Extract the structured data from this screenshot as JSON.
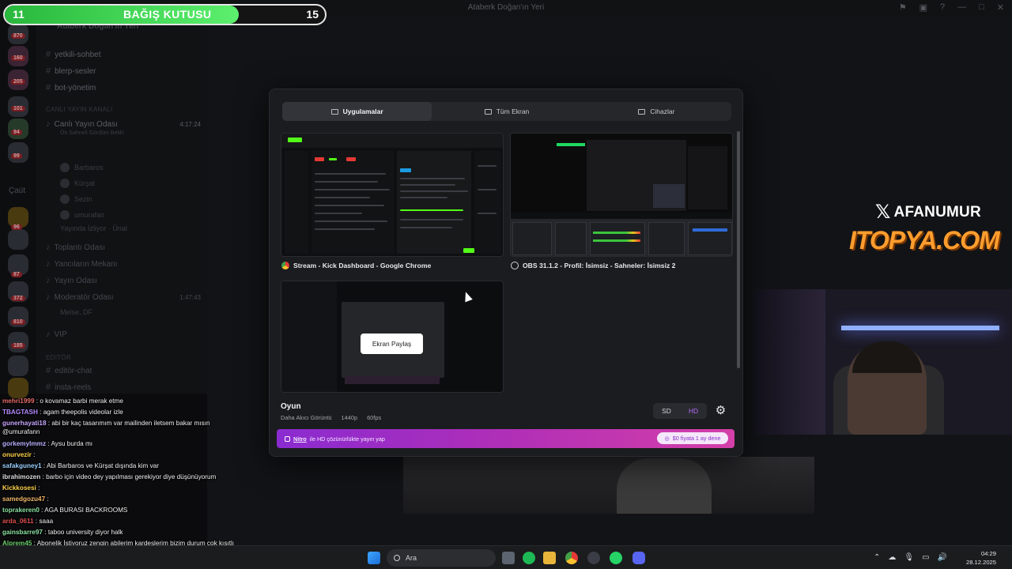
{
  "discord": {
    "server_name": "Ataberk Doğan'ın Yeri",
    "left_label": "Çaüt",
    "channels": [
      {
        "name": "yetkili-sohbet",
        "y": 0
      },
      {
        "name": "blerp-sesler",
        "y": 0
      },
      {
        "name": "bot-yönetim",
        "y": 0
      }
    ],
    "category_live": "CANLI YAYIN KANALI",
    "live_room": "Canlı Yayın Odası",
    "live_room_time": "4:17:24",
    "live_room_sub": "Ön Sahneli Gördüm Bekli!",
    "members": [
      "Barbaros",
      "Kürşat",
      "Sezin",
      "umurafan",
      "Yayında İzliyor · Ünal"
    ],
    "other_rooms": [
      "Toplantı Odası",
      "Yancıların Mekanı",
      "Yayın Odası",
      "Moderatör Odası",
      "VIP"
    ],
    "mod_time": "1:47:43",
    "mod_member": "Meise, DF",
    "category_editor": "Editör",
    "editor_channels": [
      "editör-chat",
      "insta-reels"
    ],
    "rail_badges": [
      "870",
      "160",
      "205",
      "101",
      "94",
      "99",
      "96",
      "87",
      "372",
      "810",
      "185"
    ]
  },
  "donation_bar": {
    "left": "11",
    "label": "BAĞIŞ KUTUSU",
    "right": "15",
    "progress": 0.73
  },
  "branding": {
    "x_handle": "AFANUMUR",
    "sponsor": "ITOPYA.COM"
  },
  "modal": {
    "tabs": [
      {
        "label": "Uygulamalar",
        "active": true
      },
      {
        "label": "Tüm Ekran",
        "active": false
      },
      {
        "label": "Cihazlar",
        "active": false
      }
    ],
    "sources": [
      {
        "label": "Stream - Kick Dashboard - Google Chrome",
        "icon": "chrome-icon"
      },
      {
        "label": "OBS 31.1.2 - Profil: İsimsiz - Sahneler: İsimsiz 2",
        "icon": "obs-icon"
      }
    ],
    "share_button": "Ekran Paylaş",
    "game": {
      "title": "Oyun",
      "quality_label": "Daha Akıcı Görüntü",
      "resolution": "1440p",
      "fps": "60fps"
    },
    "quality_options": [
      "SD",
      "HD"
    ],
    "selected_quality": "HD",
    "nitro": {
      "brand": "Nitro",
      "text": "ile HD çözünürlükte yayın yap",
      "button": "$0 fiyata 1 ay dene"
    }
  },
  "chat": [
    {
      "user": "mehri1999",
      "text": ": o kovamaz barbi merak etme",
      "color": "#e86b6b"
    },
    {
      "user": "TBAGTASH",
      "text": ": agam theepolis videolar izle",
      "color": "#b58cff"
    },
    {
      "user": "gunerhayati18",
      "text": ": abi bir kaç tasarımım var mailinden iletsem bakar mısın @umurafann",
      "color": "#c9a5ff"
    },
    {
      "user": "gorkemylmmz",
      "text": ": Aysu burda mı",
      "color": "#b9b0ff"
    },
    {
      "user": "onurvezir",
      "text": ":",
      "color": "#ffd24a"
    },
    {
      "user": "safakguney1",
      "text": ": Abi Barbaros ve Kürşat dışında kim var",
      "color": "#9ad0ff"
    },
    {
      "user": "ibrahimozen",
      "text": ": barbo için video dey yapılması gerekiyor diye düşünüyorum",
      "color": "#dcdcdc"
    },
    {
      "user": "Kickkosesi",
      "text": ":",
      "color": "#ffd24a"
    },
    {
      "user": "samedgozu47",
      "text": ":",
      "color": "#f0b86a"
    },
    {
      "user": "toprakeren0",
      "text": ": AGA BURASI BACKROOMS",
      "color": "#8be0a0"
    },
    {
      "user": "arda_0611",
      "text": ": saaa",
      "color": "#e05050"
    },
    {
      "user": "gainsbarre97",
      "text": ": taboo university diyor halk",
      "color": "#8be0a0"
    },
    {
      "user": "Alprem45",
      "text": ": Abonelik İstiyoruz zengin abilerim kardeşlerim bizim durum çok kısıtlı be",
      "color": "#6bd16b"
    }
  ],
  "taskbar": {
    "search_placeholder": "Ara",
    "time": "04:29",
    "date": "28.12.2025"
  }
}
